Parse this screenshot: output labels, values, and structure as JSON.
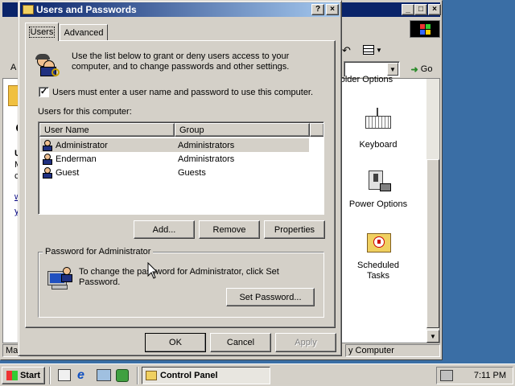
{
  "background_window": {
    "title_buttons": [
      "_",
      "□",
      "×"
    ],
    "address_prefix": "A",
    "go_label": "Go",
    "partial_text": "Folder Options",
    "left_fragments": [
      "U",
      "M",
      "c",
      "w",
      "y"
    ],
    "items": [
      {
        "label": "Keyboard",
        "icon": "keyboard-icon"
      },
      {
        "label": "Power Options",
        "icon": "power-options-icon"
      },
      {
        "label": "Scheduled Tasks",
        "icon": "scheduled-tasks-icon"
      }
    ],
    "status_left": "Mar",
    "status_right": "y Computer"
  },
  "dialog": {
    "title": "Users and Passwords",
    "help_btn": "?",
    "close_btn": "×",
    "tabs": [
      "Users",
      "Advanced"
    ],
    "intro": "Use the list below to grant or deny users access to your computer, and to change passwords and other settings.",
    "checkbox_label": "Users must enter a user name and password to use this computer.",
    "checkbox_checked": true,
    "list_label": "Users for this computer:",
    "columns": [
      "User Name",
      "Group"
    ],
    "users": [
      {
        "name": "Administrator",
        "group": "Administrators",
        "selected": true
      },
      {
        "name": "Enderman",
        "group": "Administrators",
        "selected": false
      },
      {
        "name": "Guest",
        "group": "Guests",
        "selected": false
      }
    ],
    "add_btn": "Add...",
    "remove_btn": "Remove",
    "properties_btn": "Properties",
    "pw_group_label": "Password for Administrator",
    "pw_text": "To change the password for Administrator, click Set Password.",
    "set_password_btn": "Set Password...",
    "ok_btn": "OK",
    "cancel_btn": "Cancel",
    "apply_btn": "Apply"
  },
  "taskbar": {
    "start_label": "Start",
    "task_label": "Control Panel",
    "time": "7:11 PM"
  },
  "colors": {
    "desktop": "#3a6ea5",
    "titlebar_active": "#0a246a",
    "face": "#d4d0c8"
  }
}
